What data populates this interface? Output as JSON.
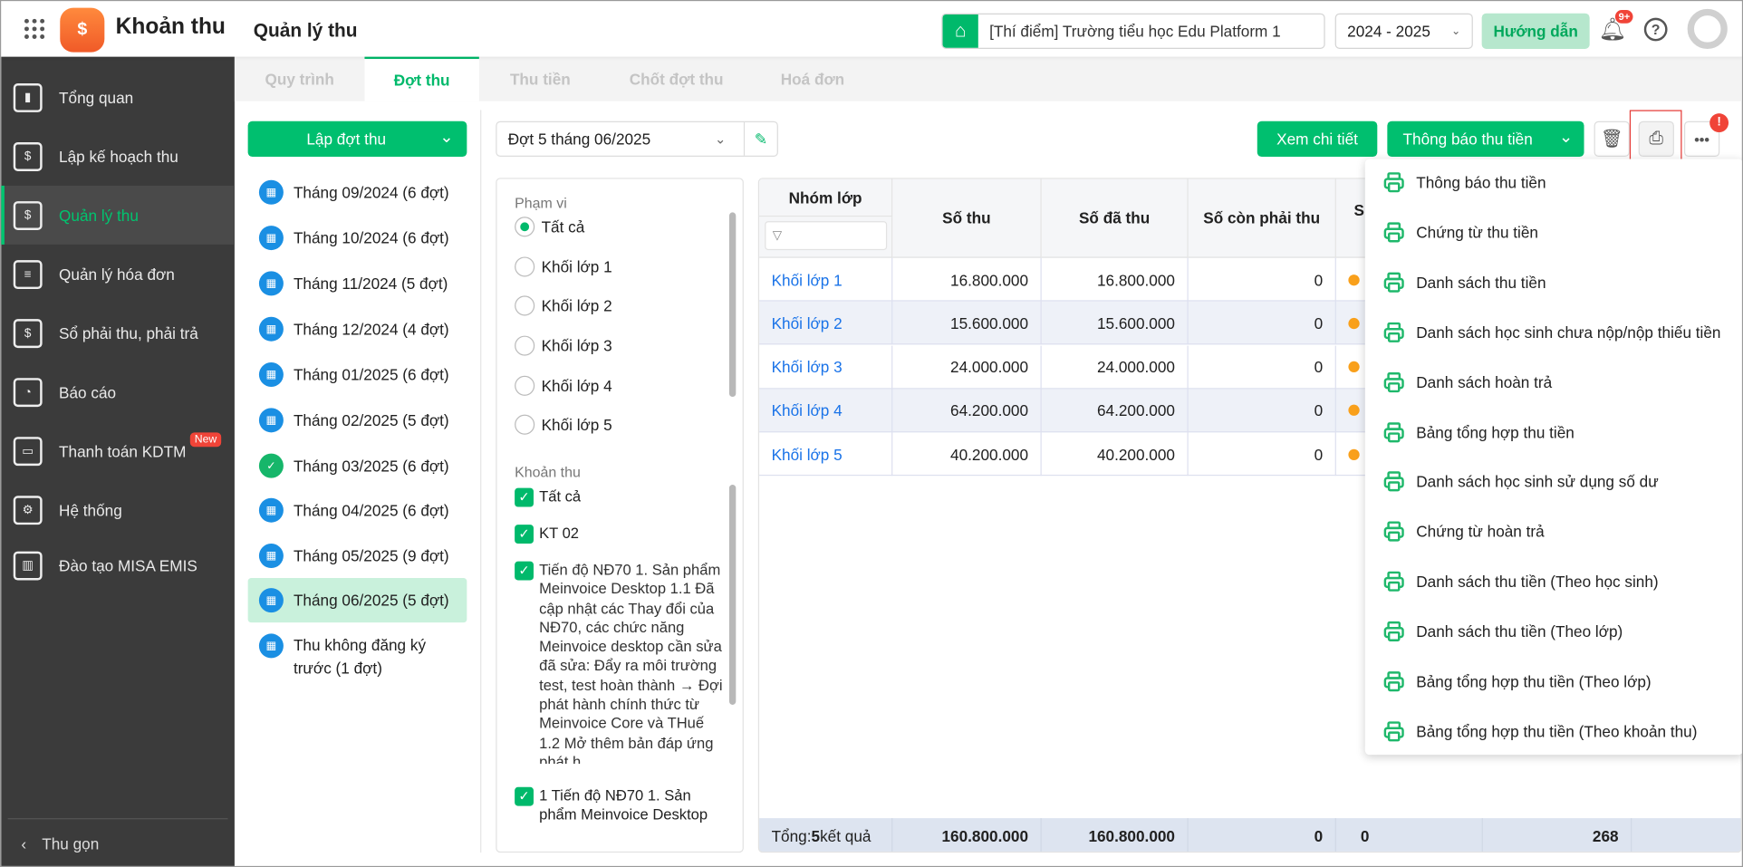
{
  "header": {
    "app_title": "Khoản thu",
    "page_title": "Quản lý thu",
    "school": "[Thí điểm] Trường tiểu học Edu Platform 1",
    "year": "2024 - 2025",
    "guide_label": "Hướng dẫn",
    "notification_badge": "9+"
  },
  "sidebar": {
    "items": [
      {
        "label": "Tổng quan",
        "icon": "bar-chart-icon"
      },
      {
        "label": "Lập kế hoạch thu",
        "icon": "calendar-money-icon"
      },
      {
        "label": "Quản lý thu",
        "icon": "hand-coin-icon",
        "active": true
      },
      {
        "label": "Quản lý hóa đơn",
        "icon": "invoice-icon"
      },
      {
        "label": "Sổ phải thu, phải trả",
        "icon": "ledger-icon"
      },
      {
        "label": "Báo cáo",
        "icon": "pie-chart-icon"
      },
      {
        "label": "Thanh toán KDTM",
        "icon": "card-icon",
        "badge": "New"
      },
      {
        "label": "Hệ thống",
        "icon": "gear-icon"
      },
      {
        "label": "Đào tạo MISA EMIS",
        "icon": "book-icon"
      }
    ],
    "collapse_label": "Thu gọn"
  },
  "tabs": [
    "Quy trình",
    "Đợt thu",
    "Thu tiền",
    "Chốt đợt thu",
    "Hoá đơn"
  ],
  "active_tab": "Đợt thu",
  "periods": {
    "create_label": "Lập đợt thu",
    "items": [
      "Tháng 09/2024 (6 đợt)",
      "Tháng 10/2024 (6 đợt)",
      "Tháng 11/2024 (5 đợt)",
      "Tháng 12/2024 (4 đợt)",
      "Tháng 01/2025 (6 đợt)",
      "Tháng 02/2025 (5 đợt)",
      "Tháng 03/2025 (6 đợt)",
      "Tháng 04/2025 (6 đợt)",
      "Tháng 05/2025 (9 đợt)",
      "Tháng 06/2025 (5 đợt)",
      "Thu không đăng ký trước (1 đợt)"
    ],
    "active": "Tháng 06/2025 (5 đợt)",
    "completed": "Tháng 03/2025 (6 đợt)"
  },
  "batch_select": "Đợt 5 tháng 06/2025",
  "filter": {
    "scope_label": "Phạm vi",
    "scope_options": [
      "Tất cả",
      "Khối lớp 1",
      "Khối lớp 2",
      "Khối lớp 3",
      "Khối lớp 4",
      "Khối lớp 5"
    ],
    "scope_selected": "Tất cả",
    "fee_label": "Khoản thu",
    "fee_options": [
      "Tất cả",
      "KT 02",
      "Tiến độ NĐ70 1. Sản phẩm Meinvoice Desktop 1.1 Đã cập nhật các Thay đổi của NĐ70, các chức năng Meinvoice desktop cần sửa đã sửa: Đẩy ra môi trường test, test hoàn thành → Đợi phát hành chính thức từ Meinvoice Core và THuế 1.2 Mở thêm bản đáp ứng phát h",
      "1 Tiến độ NĐ70 1. Sản phẩm Meinvoice Desktop"
    ]
  },
  "toolbar": {
    "detail_label": "Xem chi tiết",
    "notify_label": "Thông báo thu tiền"
  },
  "table": {
    "columns": [
      "Nhóm lớp",
      "Số thu",
      "Số đã thu",
      "Số còn phải thu",
      "S"
    ],
    "rows": [
      {
        "group": "Khối lớp 1",
        "total": "16.800.000",
        "paid": "16.800.000",
        "remaining": "0"
      },
      {
        "group": "Khối lớp 2",
        "total": "15.600.000",
        "paid": "15.600.000",
        "remaining": "0"
      },
      {
        "group": "Khối lớp 3",
        "total": "24.000.000",
        "paid": "24.000.000",
        "remaining": "0"
      },
      {
        "group": "Khối lớp 4",
        "total": "64.200.000",
        "paid": "64.200.000",
        "remaining": "0"
      },
      {
        "group": "Khối lớp 5",
        "total": "40.200.000",
        "paid": "40.200.000",
        "remaining": "0"
      }
    ],
    "footer": {
      "label_prefix": "Tổng: ",
      "count": "5",
      "label_suffix": " kết quả",
      "total": "160.800.000",
      "paid": "160.800.000",
      "remaining": "0",
      "col5": "0",
      "col6": "268"
    }
  },
  "print_menu": [
    "Thông báo thu tiền",
    "Chứng từ thu tiền",
    "Danh sách thu tiền",
    "Danh sách học sinh chưa nộp/nộp thiếu tiền",
    "Danh sách hoàn trả",
    "Bảng tổng hợp thu tiền",
    "Danh sách học sinh sử dụng số dư",
    "Chứng từ hoàn trả",
    "Danh sách thu tiền (Theo học sinh)",
    "Danh sách thu tiền (Theo lớp)",
    "Bảng tổng hợp thu tiền (Theo lớp)",
    "Bảng tổng hợp thu tiền (Theo khoản thu)"
  ],
  "colors": {
    "primary": "#00bf6f",
    "link": "#1a73e8",
    "sidebar": "#3b3b3b",
    "warning_dot": "#f9a01b",
    "alert": "#f04438"
  }
}
